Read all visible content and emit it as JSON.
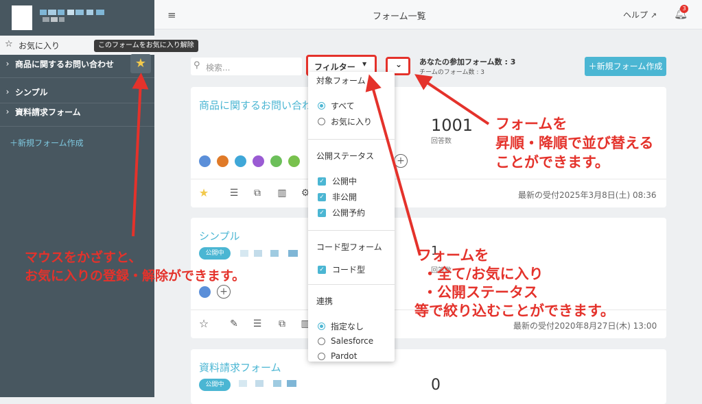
{
  "sidebar": {
    "favorites_label": "お気に入り",
    "items": [
      {
        "label": "商品に関するお問い合わせ"
      },
      {
        "label": "シンプル"
      },
      {
        "label": "資料請求フォーム"
      }
    ],
    "new_form_label": "＋新規フォーム作成",
    "tooltip": "このフォームをお気に入り解除"
  },
  "header": {
    "title": "フォーム一覧",
    "help_label": "ヘルプ",
    "notification_count": "3"
  },
  "toolbar": {
    "search_placeholder": "検索...",
    "filter_label": "フィルター",
    "participating_forms": "あなたの参加フォーム数 : 3",
    "team_forms": "チームのフォーム数 : 3",
    "create_label": "＋新規フォーム作成"
  },
  "forms": [
    {
      "title": "商品に関するお問い合わせ",
      "count": "1001",
      "count_label": "回答数",
      "received": "最新の受付2025年3月8日(土) 08:36"
    },
    {
      "title": "シンプル",
      "status": "公開中",
      "count_partial": "1",
      "count_label_partial": "回答数",
      "received": "最新の受付2020年8月27日(木) 13:00"
    },
    {
      "title": "資料請求フォーム",
      "status": "公開中",
      "count": "0"
    }
  ],
  "filter_menu": {
    "target_header": "対象フォーム",
    "target_options": [
      "すべて",
      "お気に入り"
    ],
    "status_header": "公開ステータス",
    "status_options": [
      "公開中",
      "非公開",
      "公開予約"
    ],
    "code_header": "コード型フォーム",
    "code_options": [
      "コード型"
    ],
    "link_header": "連携",
    "link_options": [
      "指定なし",
      "Salesforce",
      "Pardot"
    ]
  },
  "annotations": {
    "sort_line1": "フォームを",
    "sort_line2": "昇順・降順で並び替える",
    "sort_line3": "ことができます。",
    "filter_line1": "フォームを",
    "filter_line2": "・全て/お気に入り",
    "filter_line3": "・公開ステータス",
    "filter_line4": "等で絞り込むことができます。",
    "hover_line1": "マウスをかざすと、",
    "hover_line2": "お気に入りの登録・解除ができます。"
  },
  "colors": {
    "accent": "#4bb6d3",
    "sidebar": "#485760",
    "annotation": "#e4322b"
  }
}
